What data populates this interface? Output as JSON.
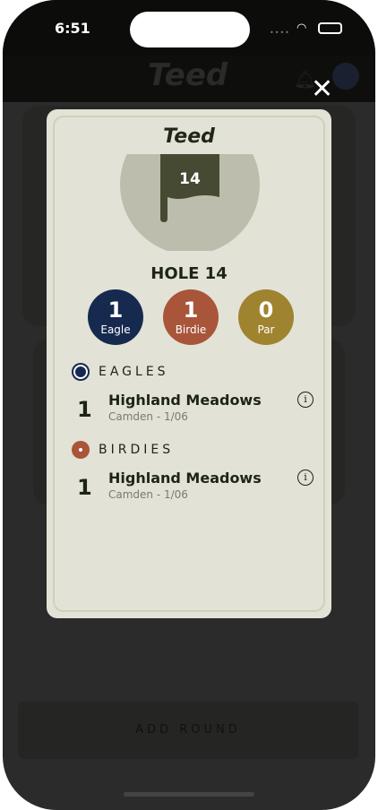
{
  "status": {
    "time": "6:51"
  },
  "header": {
    "logo": "Teed"
  },
  "modal": {
    "logo": "Teed",
    "hole_number": "14",
    "title": "HOLE 14",
    "badges": [
      {
        "count": "1",
        "label": "Eagle",
        "color": "#162a50"
      },
      {
        "count": "1",
        "label": "Birdie",
        "color": "#a9553a"
      },
      {
        "count": "0",
        "label": "Par",
        "color": "#a0832f"
      }
    ],
    "sections": [
      {
        "title": "EAGLES",
        "color": "#162a50",
        "entries": [
          {
            "count": "1",
            "course": "Highland Meadows",
            "detail": "Camden - 1/06"
          }
        ]
      },
      {
        "title": "BIRDIES",
        "color": "#a9553a",
        "entries": [
          {
            "count": "1",
            "course": "Highland Meadows",
            "detail": "Camden - 1/06"
          }
        ]
      }
    ]
  },
  "footer": {
    "add_round": "ADD ROUND"
  }
}
